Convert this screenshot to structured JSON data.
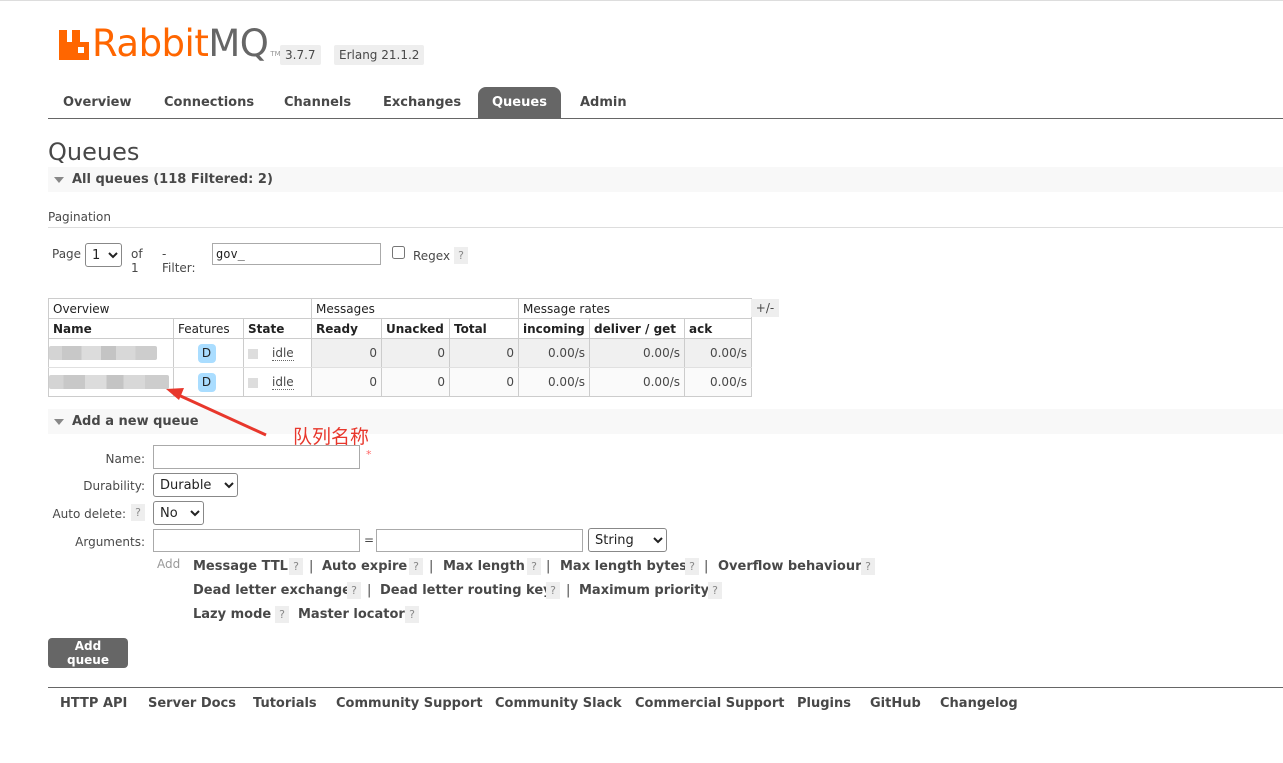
{
  "brand": {
    "logo_text_rabbit": "Rabbit",
    "logo_text_mq": "MQ",
    "logo_tm": "TM",
    "version": "3.7.7",
    "erlang": "Erlang 21.1.2",
    "brand_color": "#ff6600"
  },
  "tabs": [
    "Overview",
    "Connections",
    "Channels",
    "Exchanges",
    "Queues",
    "Admin"
  ],
  "active_tab": "Queues",
  "page_title": "Queues",
  "all_queues_label": "All queues (118 Filtered: 2)",
  "pagination": {
    "title": "Pagination",
    "page_label": "Page",
    "page_value": "1",
    "of_label": "of 1",
    "filter_label": "- Filter:",
    "filter_value": "gov_",
    "regex_label": "Regex",
    "help": "?"
  },
  "table": {
    "group_overview": "Overview",
    "group_messages": "Messages",
    "group_rates": "Message rates",
    "plus_minus": "+/-",
    "columns": [
      "Name",
      "Features",
      "State",
      "Ready",
      "Unacked",
      "Total",
      "incoming",
      "deliver / get",
      "ack"
    ],
    "rows": [
      {
        "feature": "D",
        "state": "idle",
        "ready": "0",
        "unacked": "0",
        "total": "0",
        "incoming": "0.00/s",
        "deliver": "0.00/s",
        "ack": "0.00/s"
      },
      {
        "feature": "D",
        "state": "idle",
        "ready": "0",
        "unacked": "0",
        "total": "0",
        "incoming": "0.00/s",
        "deliver": "0.00/s",
        "ack": "0.00/s"
      }
    ]
  },
  "annotation": {
    "text": "队列名称",
    "color": "#e8372c"
  },
  "add_queue": {
    "section_label": "Add a new queue",
    "name_label": "Name:",
    "name_value": "",
    "required_mark": "*",
    "durability_label": "Durability:",
    "durability_value": "Durable",
    "auto_delete_label": "Auto delete:",
    "auto_delete_value": "No",
    "arguments_label": "Arguments:",
    "equals": "=",
    "arg_type_value": "String",
    "add_label": "Add",
    "arg_links": [
      "Message TTL",
      "Auto expire",
      "Max length",
      "Max length bytes",
      "Overflow behaviour",
      "Dead letter exchange",
      "Dead letter routing key",
      "Maximum priority",
      "Lazy mode",
      "Master locator"
    ],
    "separator": "|",
    "submit_label": "Add queue"
  },
  "footer": [
    "HTTP API",
    "Server Docs",
    "Tutorials",
    "Community Support",
    "Community Slack",
    "Commercial Support",
    "Plugins",
    "GitHub",
    "Changelog"
  ]
}
